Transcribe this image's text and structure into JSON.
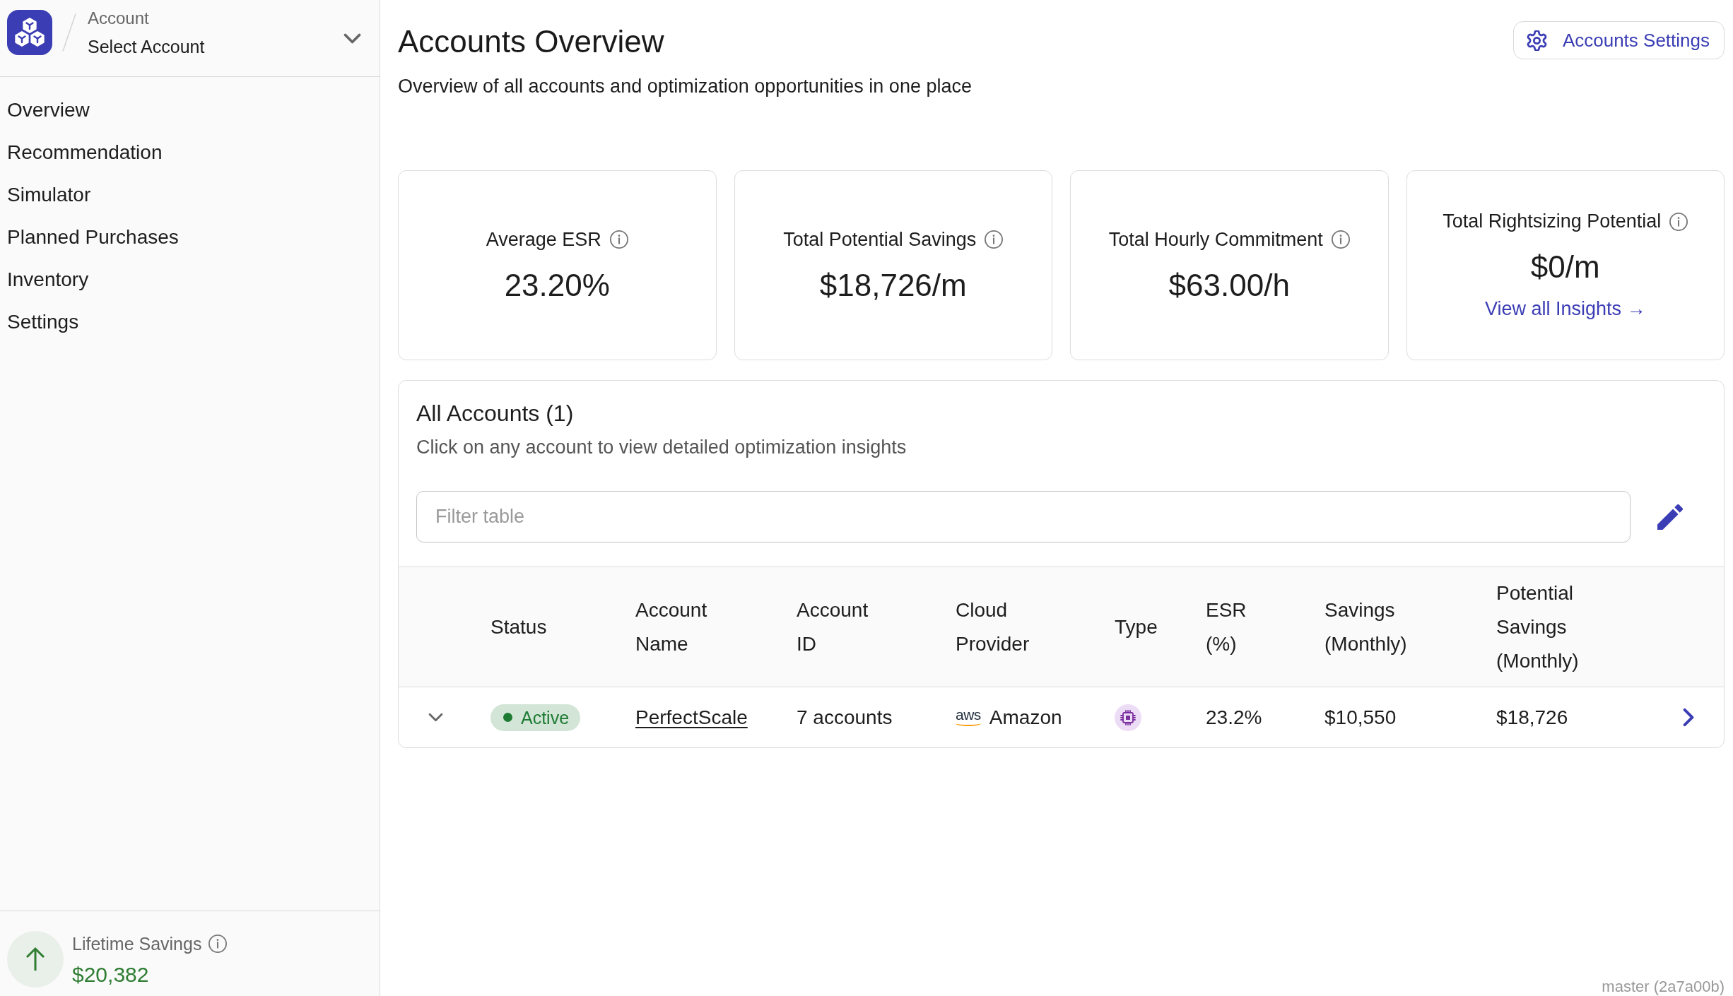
{
  "sidebar": {
    "account_switcher": {
      "label": "Account",
      "value": "Select Account"
    },
    "nav": [
      {
        "label": "Overview",
        "selected": false
      },
      {
        "label": "Recommendation",
        "selected": false
      },
      {
        "label": "Simulator",
        "selected": false
      },
      {
        "label": "Planned Purchases",
        "selected": false
      },
      {
        "label": "Inventory",
        "selected": false
      },
      {
        "label": "Settings",
        "selected": false
      }
    ],
    "lifetime_savings": {
      "label": "Lifetime Savings",
      "value": "$20,382"
    }
  },
  "page": {
    "title": "Accounts Overview",
    "subtitle": "Overview of all accounts and optimization opportunities in one place",
    "settings_button": "Accounts Settings"
  },
  "stats": [
    {
      "label": "Average ESR",
      "value": "23.20%"
    },
    {
      "label": "Total Potential Savings",
      "value": "$18,726/m"
    },
    {
      "label": "Total Hourly Commitment",
      "value": "$63.00/h"
    },
    {
      "label": "Total Rightsizing Potential",
      "value": "$0/m",
      "link": "View all Insights →"
    }
  ],
  "accounts": {
    "title": "All Accounts (1)",
    "subtitle": "Click on any account to view detailed optimization insights",
    "filter": {
      "placeholder": "Filter table"
    },
    "table": {
      "columns": [
        "Status",
        "Account Name",
        "Account ID",
        "Cloud Provider",
        "Type",
        "ESR (%)",
        "Savings (Monthly)",
        "Potential Savings (Monthly)"
      ],
      "rows": [
        {
          "expanded": false,
          "status": {
            "label": "Active",
            "color": "#1e7b34"
          },
          "account_name": "PerfectScale",
          "account_id": "7 accounts",
          "cloud_provider": {
            "logo": "aws",
            "name": "Amazon"
          },
          "type": {
            "kind": "compute"
          },
          "esr": "23.2%",
          "savings": "$10,550",
          "potential_savings": "$18,726"
        }
      ]
    }
  },
  "footer": {
    "version": "master (2a7a00b)"
  }
}
